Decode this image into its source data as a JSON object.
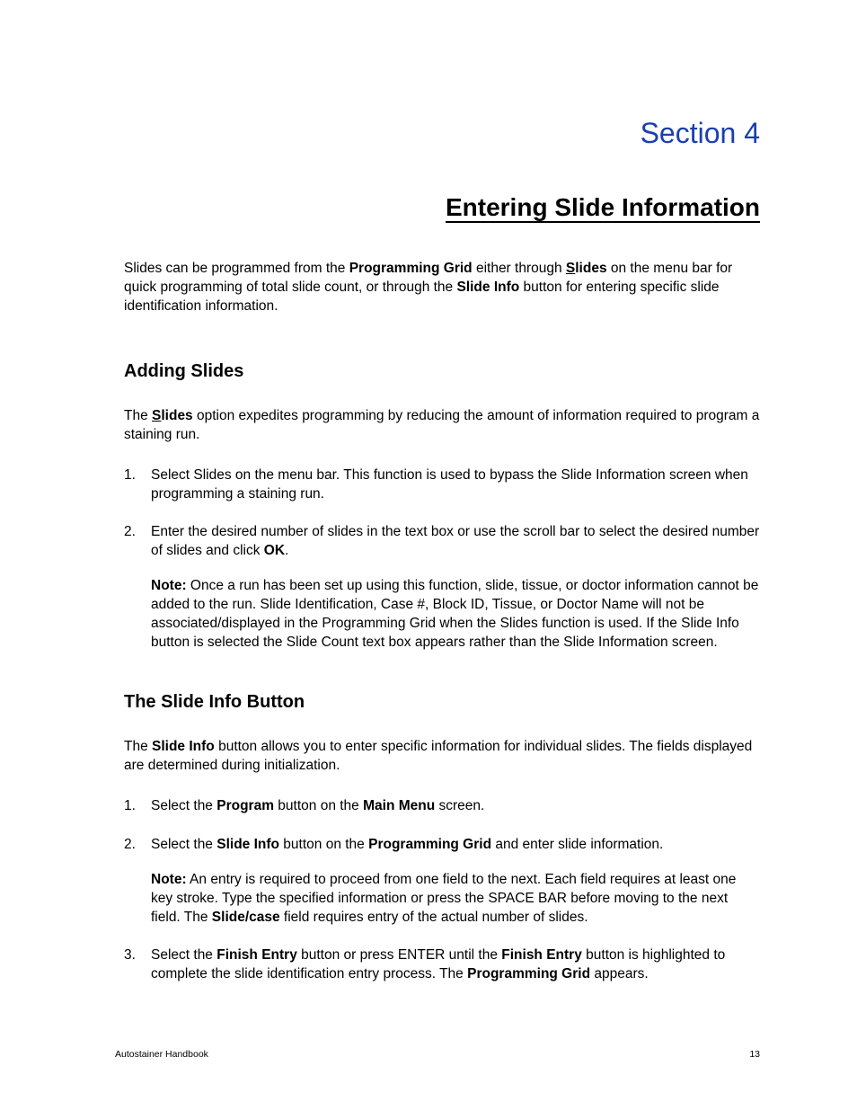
{
  "section_label": "Section 4",
  "title": "Entering Slide Information",
  "intro": {
    "t1": "Slides can be programmed from the ",
    "b1": "Programming Grid",
    "t2": " either through ",
    "b2_u": "S",
    "b2_rest": "lides",
    "t3": " on the menu bar for quick programming of total slide count, or through the ",
    "b3": "Slide Info",
    "t4": " button for entering specific slide identification information."
  },
  "s1": {
    "heading": "Adding Slides",
    "lead": {
      "t1": "The ",
      "b1_u": "S",
      "b1_rest": "lides",
      "t2": " option expedites programming by reducing the amount of information required to program a staining run."
    },
    "items": [
      {
        "num": "1.",
        "text": "Select Slides on the menu bar. This function is used to bypass the Slide Information screen when programming a staining run."
      },
      {
        "num": "2.",
        "t1": "Enter the desired number of slides in the text box or use the scroll bar to select the desired number of slides and click ",
        "b1": "OK",
        "t2": ".",
        "note_b": "Note:",
        "note_t": " Once a run has been set up using this function, slide, tissue, or doctor information cannot be added to the run. Slide Identification, Case #, Block ID, Tissue, or Doctor Name will not be associated/displayed in the Programming Grid when the Slides function is used. If the Slide Info button is selected the Slide Count text box appears rather than the Slide Information screen."
      }
    ]
  },
  "s2": {
    "heading": "The Slide Info Button",
    "lead": {
      "t1": "The ",
      "b1": "Slide Info",
      "t2": " button allows you to enter specific information for individual slides. The fields displayed are determined during initialization."
    },
    "items": [
      {
        "num": "1.",
        "t1": "Select the ",
        "b1": "Program",
        "t2": " button on the ",
        "b2": "Main Menu",
        "t3": " screen."
      },
      {
        "num": "2.",
        "t1": "Select the ",
        "b1": "Slide Info",
        "t2": " button on the ",
        "b2": "Programming Grid",
        "t3": " and enter slide information.",
        "note_b": "Note:",
        "note_t1": " An entry is required to proceed from one field to the next. Each field requires at least one key stroke. Type the specified information or press the SPACE BAR before moving to the next field. The ",
        "note_b2": "Slide/case",
        "note_t2": " field requires entry of the actual number of slides."
      },
      {
        "num": "3.",
        "t1": "Select the ",
        "b1": "Finish Entry",
        "t2": " button or press ENTER until the ",
        "b2": "Finish Entry",
        "t3": " button is highlighted to complete the slide identification entry process. The ",
        "b3": "Programming Grid",
        "t4": " appears."
      }
    ]
  },
  "footer": {
    "left": "Autostainer Handbook",
    "right": "13"
  }
}
